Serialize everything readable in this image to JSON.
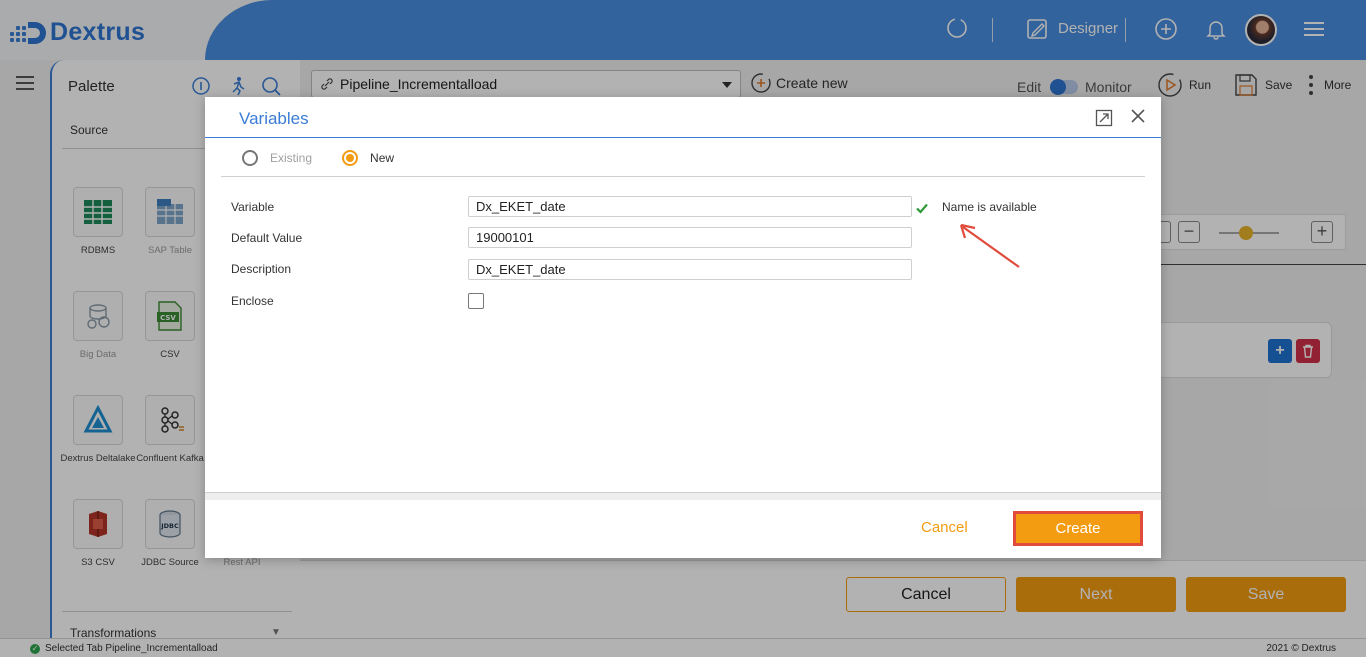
{
  "app": {
    "brand": "Dextrus",
    "designer_label": "Designer"
  },
  "palette": {
    "title": "Palette",
    "source_label": "Source",
    "transformations_label": "Transformations",
    "tiles": [
      {
        "label": "RDBMS",
        "icon": "rdbms-icon"
      },
      {
        "label": "SAP Table",
        "icon": "sap-table-icon"
      },
      {
        "label": "Big Data",
        "icon": "big-data-icon"
      },
      {
        "label": "CSV",
        "icon": "csv-icon"
      },
      {
        "label": "Dextrus Deltalake",
        "icon": "deltalake-icon"
      },
      {
        "label": "Confluent Kafka",
        "icon": "kafka-icon"
      },
      {
        "label": "S3 CSV",
        "icon": "s3-csv-icon"
      },
      {
        "label": "JDBC Source",
        "icon": "jdbc-icon"
      },
      {
        "label": "Rest API",
        "icon": "rest-api-icon"
      }
    ]
  },
  "toolbar": {
    "pipeline_value": "Pipeline_Incrementalload",
    "create_new_label": "Create new",
    "mode_edit": "Edit",
    "mode_monitor": "Monitor",
    "run_label": "Run",
    "save_label": "Save",
    "more_label": "More"
  },
  "footer_buttons": {
    "cancel": "Cancel",
    "next": "Next",
    "save": "Save"
  },
  "status": {
    "left": "Selected Tab Pipeline_Incrementalload",
    "right": "2021 © Dextrus"
  },
  "dialog": {
    "title": "Variables",
    "radio_existing": "Existing",
    "radio_new": "New",
    "selected_radio": "New",
    "fields": {
      "variable_label": "Variable",
      "variable_value": "Dx_EKET_date",
      "default_label": "Default Value",
      "default_value": "19000101",
      "description_label": "Description",
      "description_value": "Dx_EKET_date",
      "enclose_label": "Enclose"
    },
    "availability": "Name is available",
    "cancel_label": "Cancel",
    "create_label": "Create"
  },
  "colors": {
    "accent_blue": "#3a7dd6",
    "header_blue": "#4a8ee0",
    "accent_orange": "#f39c12",
    "highlight_red": "#e04b3b",
    "success_green": "#2e9a3a"
  }
}
